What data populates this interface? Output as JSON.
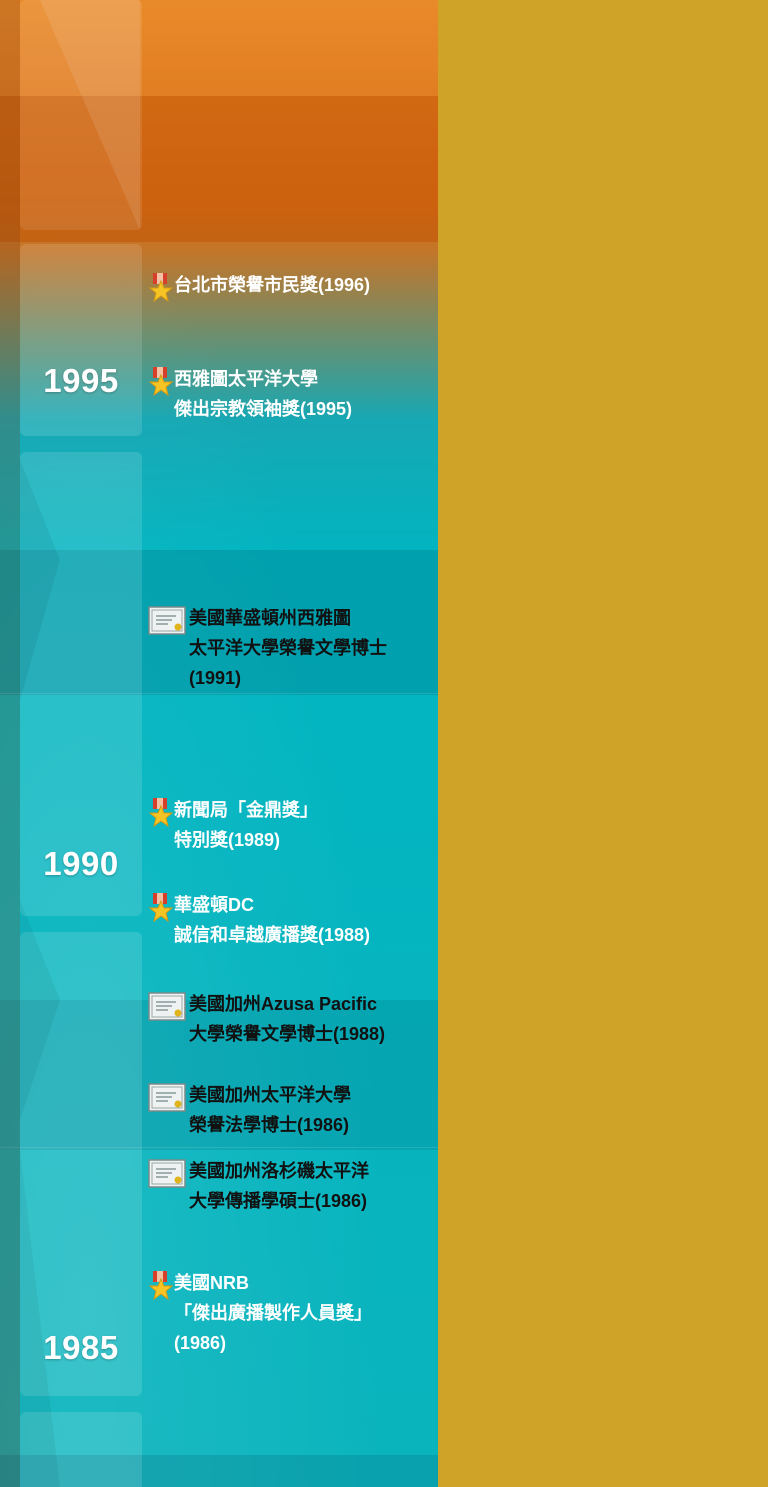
{
  "timeline": {
    "years": [
      "1995",
      "1990",
      "1985"
    ],
    "entries": [
      {
        "icon": "award-medal-icon",
        "lines": [
          "台北市榮譽市民獎(1996)"
        ],
        "color": "white"
      },
      {
        "icon": "award-medal-icon",
        "lines": [
          "西雅圖太平洋大學",
          "傑出宗教領袖獎(1995)"
        ],
        "color": "white"
      },
      {
        "icon": "certificate-icon",
        "lines": [
          "美國華盛頓州西雅圖",
          "太平洋大學榮譽文學博士",
          "(1991)"
        ],
        "color": "black"
      },
      {
        "icon": "award-medal-icon",
        "lines": [
          "新聞局「金鼎獎」",
          "特別獎(1989)"
        ],
        "color": "white"
      },
      {
        "icon": "award-medal-icon",
        "lines": [
          "華盛頓DC",
          "誠信和卓越廣播獎(1988)"
        ],
        "color": "white"
      },
      {
        "icon": "certificate-icon",
        "lines": [
          "美國加州Azusa Pacific",
          "大學榮譽文學博士(1988)"
        ],
        "color": "black"
      },
      {
        "icon": "certificate-icon",
        "lines": [
          "美國加州太平洋大學",
          "榮譽法學博士(1986)"
        ],
        "color": "black"
      },
      {
        "icon": "certificate-icon",
        "lines": [
          "美國加州洛杉磯太平洋",
          "大學傳播學碩士(1986)"
        ],
        "color": "black"
      },
      {
        "icon": "award-medal-icon",
        "lines": [
          "美國NRB",
          "「傑出廣播製作人員獎」",
          "(1986)"
        ],
        "color": "white"
      }
    ]
  },
  "colors": {
    "right_panel": "#cfa327",
    "teal": "#00b5c1",
    "orange": "#e98a2a"
  }
}
